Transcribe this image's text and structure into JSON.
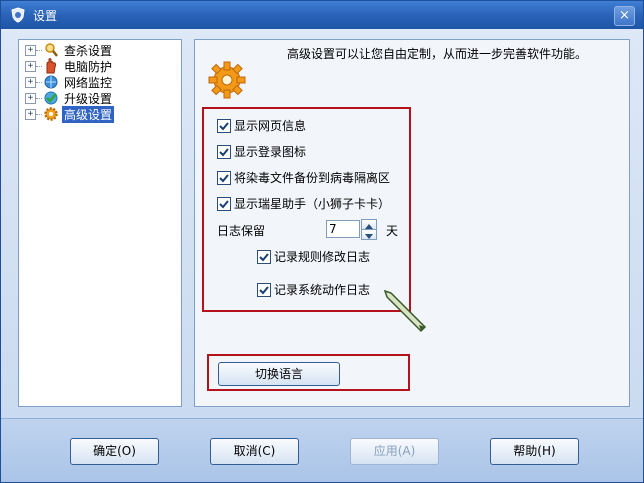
{
  "window": {
    "title": "设置",
    "close_label": "×"
  },
  "tree": {
    "items": [
      {
        "label": "查杀设置"
      },
      {
        "label": "电脑防护"
      },
      {
        "label": "网络监控"
      },
      {
        "label": "升级设置"
      },
      {
        "label": "高级设置",
        "selected": true
      }
    ]
  },
  "panel": {
    "description": "高级设置可以让您自由定制，从而进一步完善软件功能。",
    "checkboxes": [
      {
        "label": "显示网页信息",
        "checked": true
      },
      {
        "label": "显示登录图标",
        "checked": true
      },
      {
        "label": "将染毒文件备份到病毒隔离区",
        "checked": true
      },
      {
        "label": "显示瑞星助手（小狮子卡卡）",
        "checked": true
      }
    ],
    "log_keep_label": "日志保留",
    "log_keep_value": "7",
    "log_keep_unit": "天",
    "sub_checkboxes": [
      {
        "label": "记录规则修改日志",
        "checked": true
      },
      {
        "label": "记录系统动作日志",
        "checked": true
      }
    ],
    "switch_language_label": "切换语言"
  },
  "buttons": {
    "ok": "确定(O)",
    "cancel": "取消(C)",
    "apply": "应用(A)",
    "help": "帮助(H)"
  },
  "colors": {
    "highlight_red": "#b5121b",
    "selection_blue": "#2f63c4"
  }
}
